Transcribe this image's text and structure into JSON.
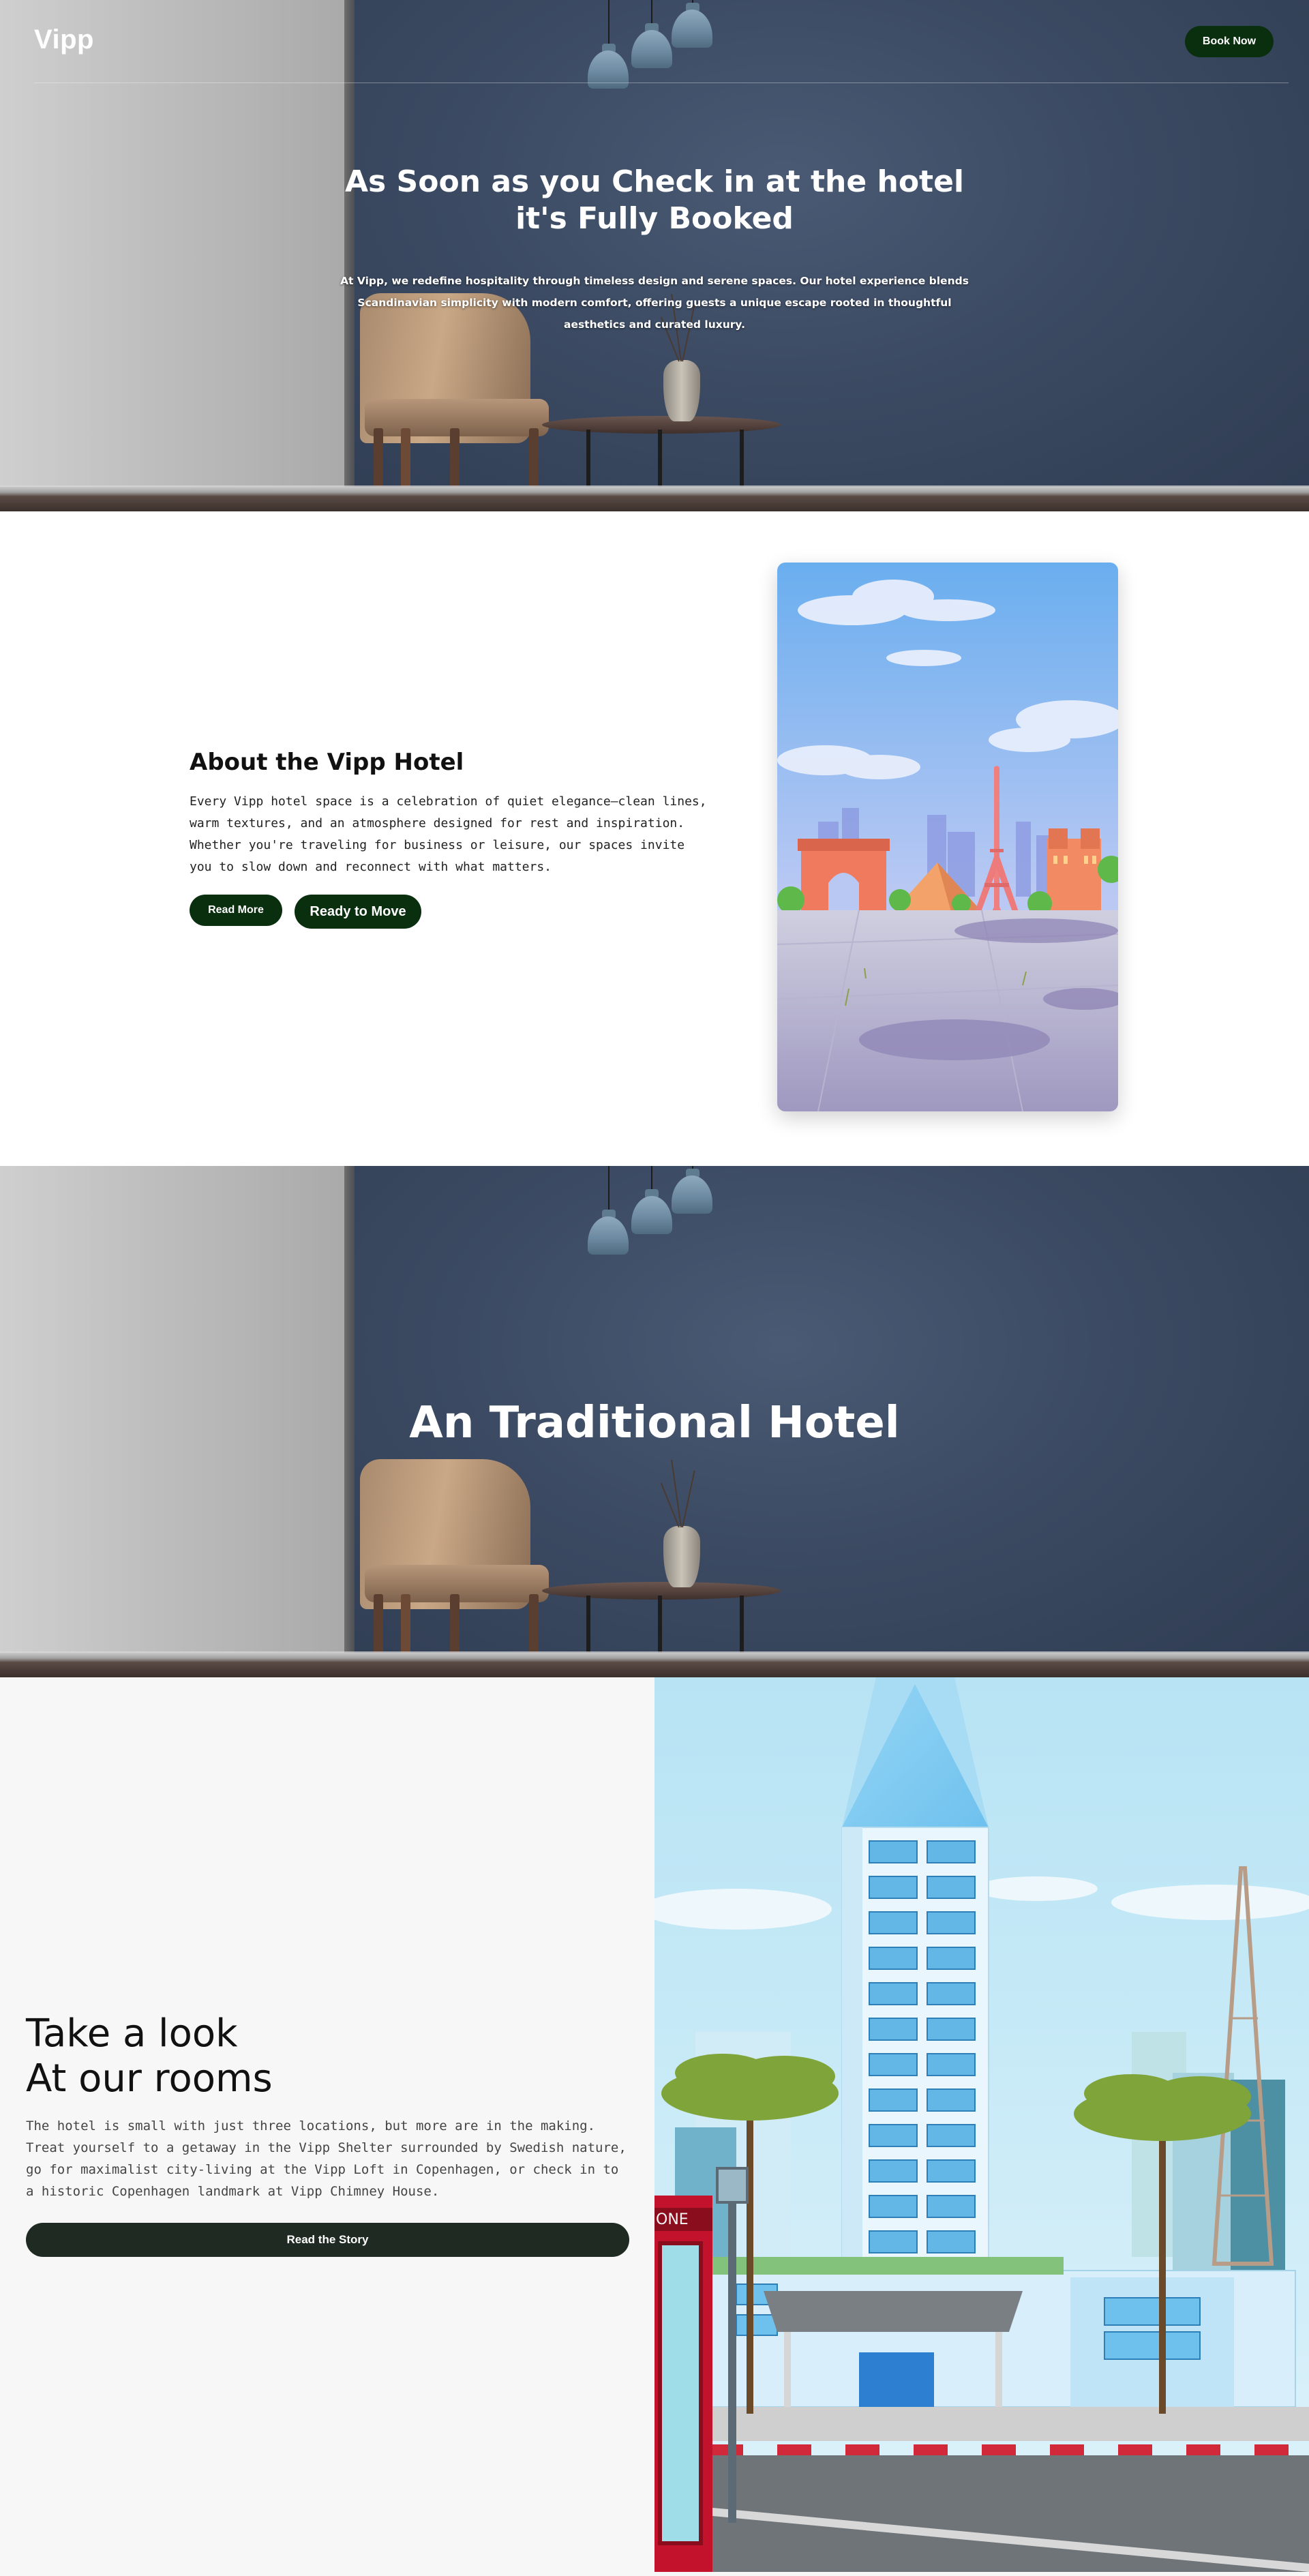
{
  "header": {
    "logo": "Vipp",
    "book_label": "Book Now"
  },
  "hero": {
    "title": "As Soon as you Check in at the hotel it's Fully Booked",
    "description": "At Vipp, we redefine hospitality through timeless design and serene spaces. Our hotel experience blends Scandinavian simplicity with modern comfort, offering guests a unique escape rooted in thoughtful aesthetics and curated luxury."
  },
  "about": {
    "title": "About the Vipp Hotel",
    "description": "Every Vipp hotel space is a celebration of quiet elegance—clean lines, warm textures, and an atmosphere designed for rest and inspiration. Whether you're traveling for business or leisure, our spaces invite you to slow down and reconnect with what matters.",
    "read_more_label": "Read More",
    "ready_label": "Ready to Move"
  },
  "traditional": {
    "title": "An Traditional Hotel"
  },
  "rooms": {
    "title_line1": "Take a look",
    "title_line2": "At our rooms",
    "description": "The hotel is small with just three locations, but more are in the making. Treat yourself to a getaway in the Vipp Shelter surrounded by Swedish nature, go for maximalist city-living at the Vipp Loft in Copenhagen, or check in to a historic Copenhagen landmark at Vipp Chimney House.",
    "story_label": "Read the Story",
    "phone_booth_text": "ONE"
  },
  "colors": {
    "accent": "#0a2f0f",
    "story_button": "#1e2a22",
    "hero_wall": "#3b4a62"
  }
}
